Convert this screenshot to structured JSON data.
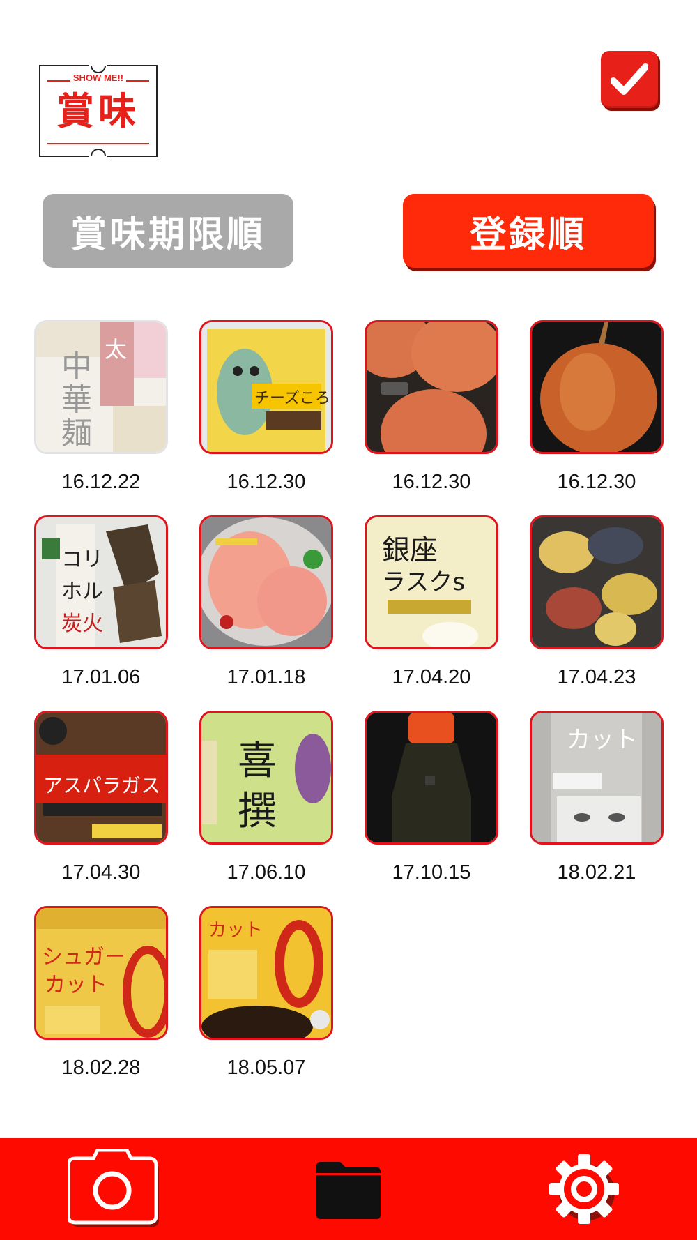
{
  "logo": {
    "small_text": "SHOW ME!!",
    "big_text": "賞味"
  },
  "header": {
    "check_icon": "checkmark-icon"
  },
  "sort": {
    "expiry_label": "賞味期限順",
    "registered_label": "登録順",
    "active": "registered"
  },
  "colors": {
    "brand_red": "#e8201a",
    "tabbar_red": "#ff0a00",
    "inactive_gray": "#a9a9a9"
  },
  "items": [
    {
      "date": "16.12.22",
      "image": "chuka-men-noodles",
      "expired": true
    },
    {
      "date": "16.12.30",
      "image": "cheese-snack-bag",
      "expired": false
    },
    {
      "date": "16.12.30",
      "image": "eggs",
      "expired": false
    },
    {
      "date": "16.12.30",
      "image": "onion",
      "expired": false
    },
    {
      "date": "17.01.06",
      "image": "hormone-snack",
      "expired": false
    },
    {
      "date": "17.01.18",
      "image": "ham-salad",
      "expired": false
    },
    {
      "date": "17.04.20",
      "image": "ginza-rusk",
      "expired": false
    },
    {
      "date": "17.04.23",
      "image": "shell-pasta",
      "expired": false
    },
    {
      "date": "17.04.30",
      "image": "asparagus-biscuits",
      "expired": false
    },
    {
      "date": "17.06.10",
      "image": "green-tea-bag",
      "expired": false
    },
    {
      "date": "17.10.15",
      "image": "soy-sauce-bottle",
      "expired": false
    },
    {
      "date": "18.02.21",
      "image": "sugar-cut-bottle",
      "expired": false
    },
    {
      "date": "18.02.28",
      "image": "sugar-cut-yellow",
      "expired": false
    },
    {
      "date": "18.05.07",
      "image": "sugar-cut-zero",
      "expired": false
    }
  ],
  "tabbar": {
    "tabs": [
      "camera-icon",
      "folder-icon",
      "gear-icon"
    ],
    "active": "folder-icon"
  }
}
